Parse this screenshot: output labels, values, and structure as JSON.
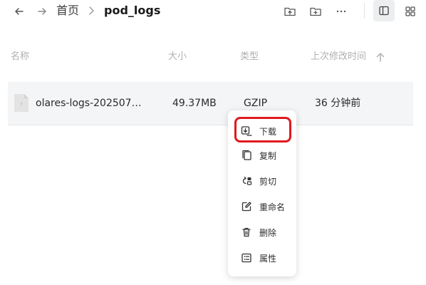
{
  "topbar": {
    "back_icon": "arrow-left-icon",
    "forward_icon": "arrow-right-icon",
    "breadcrumb": {
      "home": "首页",
      "separator": ">",
      "current": "pod_logs"
    },
    "actions": [
      "upload-folder-icon",
      "new-folder-icon",
      "more-icon",
      "sidebar-panel-icon",
      "grid-view-icon"
    ]
  },
  "table": {
    "headers": {
      "name": "名称",
      "size": "大小",
      "type": "类型",
      "modified": "上次修改时间",
      "sort_icon": "arrow-up-icon"
    },
    "rows": [
      {
        "name": "olares-logs-202507…",
        "size": "49.37MB",
        "type": "GZIP",
        "modified": "36 分钟前",
        "icon": "file-icon"
      }
    ]
  },
  "context_menu": {
    "items": [
      {
        "label": "下载",
        "icon": "download-icon"
      },
      {
        "label": "复制",
        "icon": "copy-icon"
      },
      {
        "label": "剪切",
        "icon": "cut-icon"
      },
      {
        "label": "重命名",
        "icon": "rename-icon"
      },
      {
        "label": "删除",
        "icon": "delete-icon"
      },
      {
        "label": "属性",
        "icon": "properties-icon"
      }
    ]
  },
  "colors": {
    "highlight": "#e0191f",
    "row_background": "#f4f5f7",
    "header_text": "#b0b0b0"
  }
}
